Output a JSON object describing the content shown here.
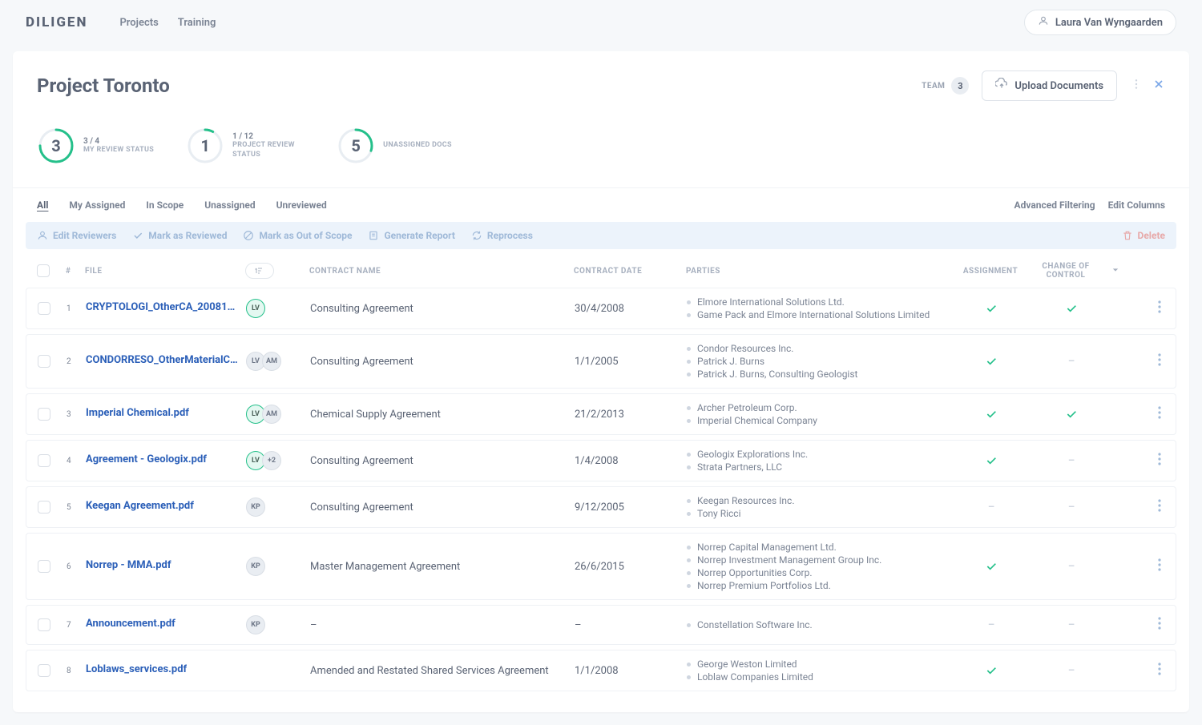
{
  "brand": "DILIGEN",
  "nav": {
    "projects": "Projects",
    "training": "Training"
  },
  "user": {
    "name": "Laura Van Wyngaarden"
  },
  "project": {
    "title": "Project Toronto",
    "team_label": "TEAM",
    "team_count": "3",
    "upload_label": "Upload Documents"
  },
  "stats": [
    {
      "num": "3",
      "sub": "3 / 4",
      "label": "MY REVIEW STATUS",
      "pct": 75
    },
    {
      "num": "1",
      "sub": "1 / 12",
      "label": "PROJECT REVIEW STATUS",
      "pct": 8
    },
    {
      "num": "5",
      "sub": "",
      "label": "UNASSIGNED DOCS",
      "pct": 30
    }
  ],
  "tabs": {
    "items": [
      "All",
      "My Assigned",
      "In Scope",
      "Unassigned",
      "Unreviewed"
    ],
    "active": 0,
    "advanced": "Advanced Filtering",
    "edit_columns": "Edit Columns"
  },
  "actions": {
    "edit_reviewers": "Edit Reviewers",
    "mark_reviewed": "Mark as Reviewed",
    "mark_out_scope": "Mark as Out of Scope",
    "generate_report": "Generate Report",
    "reprocess": "Reprocess",
    "delete": "Delete"
  },
  "columns": {
    "num": "#",
    "file": "FILE",
    "contract_name": "CONTRACT NAME",
    "contract_date": "CONTRACT DATE",
    "parties": "PARTIES",
    "assignment": "ASSIGNMENT",
    "change": "CHANGE OF CONTROL"
  },
  "rows": [
    {
      "n": "1",
      "file": "CRYPTOLOGI_OtherCA_200812…",
      "reviewers": [
        {
          "t": "LV",
          "c": "green"
        }
      ],
      "contract": "Consulting Agreement",
      "date": "30/4/2008",
      "parties": [
        "Elmore International Solutions Ltd.",
        "Game Pack and Elmore International Solutions Limited"
      ],
      "assign": true,
      "change": true
    },
    {
      "n": "2",
      "file": "CONDORRESO_OtherMaterialC…",
      "reviewers": [
        {
          "t": "LV",
          "c": "grey"
        },
        {
          "t": "AM",
          "c": "grey"
        }
      ],
      "contract": "Consulting Agreement",
      "date": "1/1/2005",
      "parties": [
        "Condor Resources Inc.",
        "Patrick J. Burns",
        "Patrick J. Burns, Consulting Geologist"
      ],
      "assign": true,
      "change": false
    },
    {
      "n": "3",
      "file": "Imperial Chemical.pdf",
      "reviewers": [
        {
          "t": "LV",
          "c": "green"
        },
        {
          "t": "AM",
          "c": "grey"
        }
      ],
      "contract": "Chemical Supply Agreement",
      "date": "21/2/2013",
      "parties": [
        "Archer Petroleum Corp.",
        "Imperial Chemical Company"
      ],
      "assign": true,
      "change": true
    },
    {
      "n": "4",
      "file": "Agreement - Geologix.pdf",
      "reviewers": [
        {
          "t": "LV",
          "c": "green"
        },
        {
          "t": "+2",
          "c": "grey"
        }
      ],
      "contract": "Consulting Agreement",
      "date": "1/4/2008",
      "parties": [
        "Geologix Explorations Inc.",
        "Strata Partners, LLC"
      ],
      "assign": true,
      "change": false
    },
    {
      "n": "5",
      "file": "Keegan Agreement.pdf",
      "reviewers": [
        {
          "t": "KP",
          "c": "grey"
        }
      ],
      "contract": "Consulting Agreement",
      "date": "9/12/2005",
      "parties": [
        "Keegan Resources Inc.",
        "Tony Ricci"
      ],
      "assign": false,
      "change": false
    },
    {
      "n": "6",
      "file": "Norrep - MMA.pdf",
      "reviewers": [
        {
          "t": "KP",
          "c": "grey"
        }
      ],
      "contract": "Master Management Agreement",
      "date": "26/6/2015",
      "parties": [
        "Norrep Capital Management Ltd.",
        "Norrep Investment Management Group Inc.",
        "Norrep Opportunities Corp.",
        "Norrep Premium Portfolios Ltd."
      ],
      "assign": true,
      "change": false
    },
    {
      "n": "7",
      "file": "Announcement.pdf",
      "reviewers": [
        {
          "t": "KP",
          "c": "grey"
        }
      ],
      "contract": "–",
      "date": "–",
      "parties": [
        "Constellation Software Inc."
      ],
      "assign": false,
      "change": false
    },
    {
      "n": "8",
      "file": "Loblaws_services.pdf",
      "reviewers": [],
      "contract": "Amended and Restated Shared Services Agreement",
      "date": "1/1/2008",
      "parties": [
        "George Weston Limited",
        "Loblaw Companies Limited"
      ],
      "assign": true,
      "change": false
    }
  ]
}
